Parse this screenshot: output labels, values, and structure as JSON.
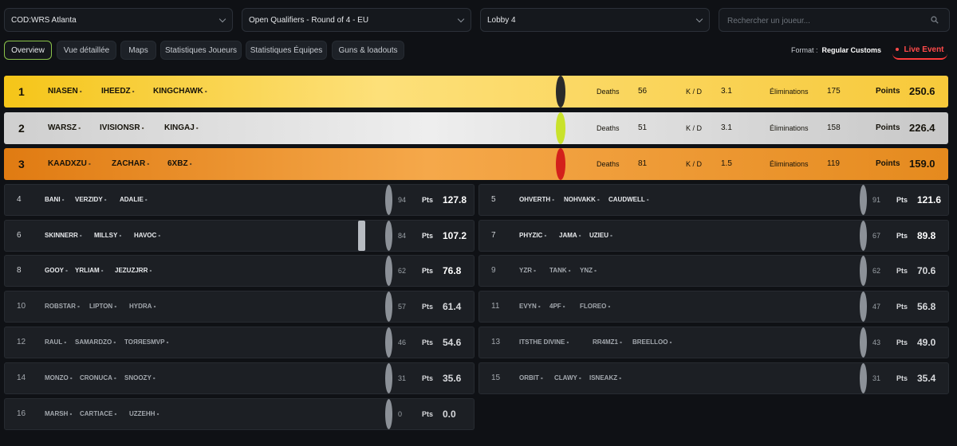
{
  "filters": {
    "game": "COD:WRS Atlanta",
    "stage": "Open Qualifiers - Round of 4 - EU",
    "lobby": "Lobby 4",
    "search_placeholder": "Rechercher un joueur..."
  },
  "tabs": [
    "Overview",
    "Vue détaillée",
    "Maps",
    "Statistiques Joueurs",
    "Statistiques Équipes",
    "Guns & loadouts"
  ],
  "format": {
    "label": "Format :",
    "value": "Regular Customs"
  },
  "live_label": "Live Event",
  "podium": [
    {
      "rank": "1",
      "players": [
        "NIASEN",
        "IHEEDZ",
        "KINGCHAWK"
      ],
      "deaths_label": "Deaths",
      "deaths": "56",
      "kd_label": "K / D",
      "kd": "3.1",
      "elims_label": "Éliminations",
      "elims": "175",
      "points_label": "Points",
      "points": "250.6",
      "team_logo": "skull-logo-icon"
    },
    {
      "rank": "2",
      "players": [
        "WARSZ",
        "IVISIONSR",
        "KINGAJ"
      ],
      "deaths_label": "Deaths",
      "deaths": "51",
      "kd_label": "K / D",
      "kd": "3.1",
      "elims_label": "Éliminations",
      "elims": "158",
      "points_label": "Points",
      "points": "226.4",
      "team_logo": "tennis-ball-logo-icon"
    },
    {
      "rank": "3",
      "players": [
        "KAADXZU",
        "ZACHAR",
        "6XBZ"
      ],
      "deaths_label": "Deaths",
      "deaths": "81",
      "kd_label": "K / D",
      "kd": "1.5",
      "elims_label": "Éliminations",
      "elims": "119",
      "points_label": "Points",
      "points": "159.0",
      "team_logo": "red-demon-logo-icon"
    }
  ],
  "teams": [
    {
      "rank": "4",
      "players": [
        "BANI",
        "VERZIDY",
        "ADALIE"
      ],
      "kills": "94",
      "pts_label": "Pts",
      "points": "127.8"
    },
    {
      "rank": "5",
      "players": [
        "OHVERTH",
        "NOHVAKK",
        "CAUDWELL"
      ],
      "kills": "91",
      "pts_label": "Pts",
      "points": "121.6"
    },
    {
      "rank": "6",
      "players": [
        "SKINNERR",
        "MILLSY",
        "HAVOC"
      ],
      "kills": "84",
      "pts_label": "Pts",
      "points": "107.2",
      "team_logo": "splat-logo-icon"
    },
    {
      "rank": "7",
      "players": [
        "PHYZIC",
        "JAMA",
        "UZIEU"
      ],
      "kills": "67",
      "pts_label": "Pts",
      "points": "89.8"
    },
    {
      "rank": "8",
      "players": [
        "GOOY",
        "YRLIAM",
        "JEZUZJRR"
      ],
      "kills": "62",
      "pts_label": "Pts",
      "points": "76.8"
    },
    {
      "rank": "9",
      "players": [
        "YZR",
        "TANK",
        "YNZ"
      ],
      "kills": "62",
      "pts_label": "Pts",
      "points": "70.6"
    },
    {
      "rank": "10",
      "players": [
        "ROBSTAR",
        "LIPTON",
        "HYDRA"
      ],
      "kills": "57",
      "pts_label": "Pts",
      "points": "61.4"
    },
    {
      "rank": "11",
      "players": [
        "EVYN",
        "4PF",
        "FLOREO"
      ],
      "kills": "47",
      "pts_label": "Pts",
      "points": "56.8"
    },
    {
      "rank": "12",
      "players": [
        "RAUL",
        "SAMARDZO",
        "TOЯЯESMVP"
      ],
      "kills": "46",
      "pts_label": "Pts",
      "points": "54.6"
    },
    {
      "rank": "13",
      "players": [
        "ITSTHE DIVINE",
        "RR4MZ1",
        "BREELLOO"
      ],
      "kills": "43",
      "pts_label": "Pts",
      "points": "49.0"
    },
    {
      "rank": "14",
      "players": [
        "MONZO",
        "CRONUCA",
        "SNOOZY"
      ],
      "kills": "31",
      "pts_label": "Pts",
      "points": "35.6"
    },
    {
      "rank": "15",
      "players": [
        "ORBIT",
        "CLAWY",
        "ISNEAKZ"
      ],
      "kills": "31",
      "pts_label": "Pts",
      "points": "35.4"
    },
    {
      "rank": "16",
      "players": [
        "MARSH",
        "CARTIACE",
        "UZZEHH"
      ],
      "kills": "0",
      "pts_label": "Pts",
      "points": "0.0"
    }
  ],
  "colors": {
    "accent_green": "#8bc34a",
    "live_red": "#ff4a4a",
    "gold": "#f5c518",
    "silver": "#d9d9d9",
    "bronze": "#e58a1e"
  }
}
